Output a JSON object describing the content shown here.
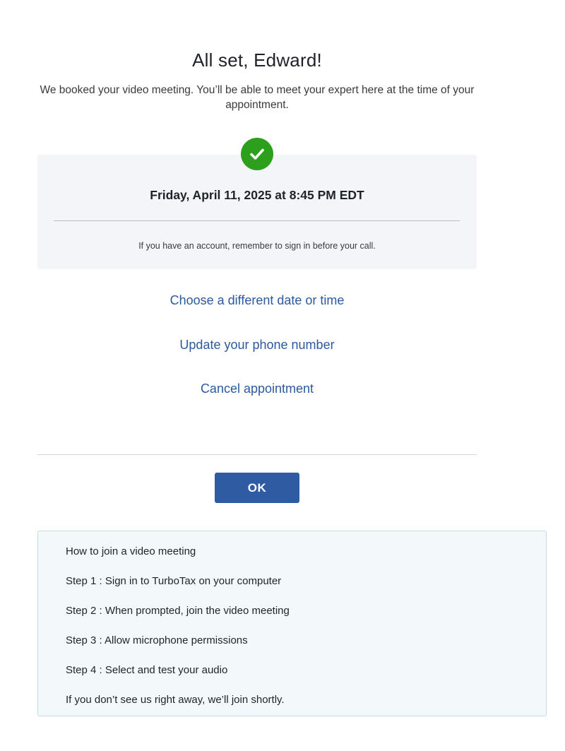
{
  "header": {
    "title": "All set, Edward!",
    "subtitle": "We booked your video meeting. You’ll be able to meet your expert here at the time of your appointment."
  },
  "confirmation": {
    "icon": "check-circle-icon",
    "datetime": "Friday, April 11, 2025 at 8:45 PM EDT",
    "note": "If you have an account, remember to sign in before your call."
  },
  "links": {
    "change_datetime": "Choose a different date or time",
    "update_phone": "Update your phone number",
    "cancel": "Cancel appointment"
  },
  "actions": {
    "ok_label": "OK"
  },
  "instructions": {
    "title": "How to join a video meeting",
    "steps": [
      "Step 1 : Sign in to TurboTax on your computer",
      "Step 2 : When prompted, join the video meeting",
      "Step 3 : Allow microphone permissions",
      "Step 4 : Select and test your audio"
    ],
    "footer": "If you don’t see us right away, we’ll join shortly."
  },
  "colors": {
    "accent_link": "#2a5aa0",
    "primary_button": "#2f5ba3",
    "success": "#2ca01c",
    "card_bg": "#f4f5f8",
    "info_bg": "#f3f9fb"
  }
}
